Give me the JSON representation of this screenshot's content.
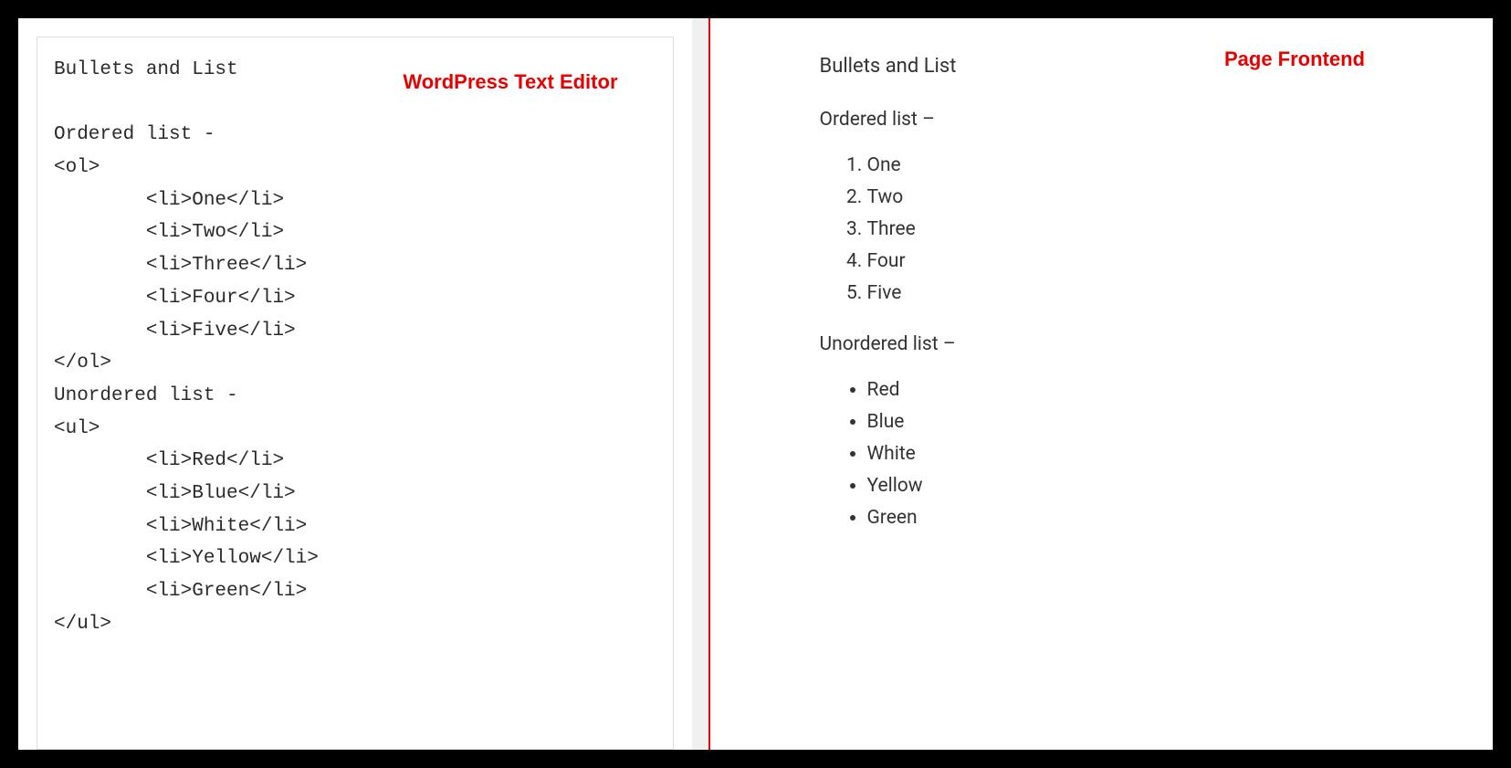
{
  "labels": {
    "editor": "WordPress Text Editor",
    "frontend": "Page Frontend"
  },
  "editor": {
    "lines": [
      "Bullets and List",
      "",
      "Ordered list -",
      "<ol>",
      "        <li>One</li>",
      "        <li>Two</li>",
      "        <li>Three</li>",
      "        <li>Four</li>",
      "        <li>Five</li>",
      "</ol>",
      "Unordered list -",
      "<ul>",
      "        <li>Red</li>",
      "        <li>Blue</li>",
      "        <li>White</li>",
      "        <li>Yellow</li>",
      "        <li>Green</li>",
      "</ul>"
    ]
  },
  "frontend": {
    "title": "Bullets and List",
    "ordered_label": "Ordered list –",
    "unordered_label": "Unordered list –",
    "ordered_items": [
      "One",
      "Two",
      "Three",
      "Four",
      "Five"
    ],
    "unordered_items": [
      "Red",
      "Blue",
      "White",
      "Yellow",
      "Green"
    ]
  }
}
